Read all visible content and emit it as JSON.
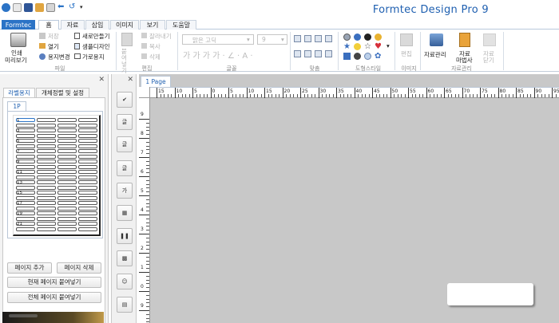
{
  "app": {
    "title": "Formtec Design Pro 9"
  },
  "ribbon_tabs": [
    {
      "label": "Formtec"
    },
    {
      "label": "홈"
    },
    {
      "label": "자료"
    },
    {
      "label": "삽입"
    },
    {
      "label": "이미지"
    },
    {
      "label": "보기"
    },
    {
      "label": "도움말"
    }
  ],
  "ribbon": {
    "print_preview": "인쇄\n미리보기",
    "print_label": "인쇄",
    "preview_label": "미리보기",
    "save": "저장",
    "open": "열기",
    "paper_change": "용지변경",
    "new_make": "새로만들기",
    "sample_design": "샘플디자인",
    "landscape": "가로용지",
    "file_group": "파일",
    "paste": "붙여넣기",
    "cut": "잘라내기",
    "copy": "복사",
    "delete": "삭제",
    "edit_group": "편집",
    "font_name": "맑은 고딕",
    "font_size": "9",
    "font_group": "글꼴",
    "align_group": "맞춤",
    "shape_style_group": "스타일",
    "shape_style_prefix": "도형",
    "image_edit": "편집",
    "image_group": "이미지",
    "data_manage": "자료관리",
    "data_wizard_1": "자료",
    "data_wizard_2": "마법사",
    "data_close_1": "자료",
    "data_close_2": "닫기",
    "data_group": "자료관리"
  },
  "left_panel": {
    "tab_label": "라벨용지",
    "tab_object": "개체정렬 및 설정",
    "page_tab": "1P",
    "rows": [
      "1",
      "3",
      "5",
      "7",
      "9",
      "11",
      "13",
      "15",
      "17",
      "19",
      "21"
    ],
    "btn_add_page": "페이지 추가",
    "btn_delete_page": "페이지 삭제",
    "btn_paste_current": "현재 페이지 붙여넣기",
    "btn_paste_all": "전체 페이지 붙여넣기"
  },
  "object_tools": [
    "선택",
    "글",
    "글",
    "글",
    "가",
    "바코드",
    "바코드",
    "QR",
    "사람",
    "표"
  ],
  "document": {
    "page_tab": "1 Page",
    "ruler_top": [
      "15",
      "10",
      "5",
      "0",
      "5",
      "10",
      "15",
      "20",
      "25",
      "30",
      "35",
      "40",
      "45",
      "50",
      "55",
      "60",
      "65",
      "70",
      "75",
      "80",
      "85",
      "90",
      "95"
    ],
    "ruler_left": [
      "9",
      "8",
      "7",
      "6",
      "5",
      "4",
      "3",
      "2",
      "1",
      "0",
      "9"
    ]
  },
  "colors": {
    "accent": "#2b73c6",
    "title": "#1e5fb0",
    "canvas_bg": "#c8c8c8"
  }
}
